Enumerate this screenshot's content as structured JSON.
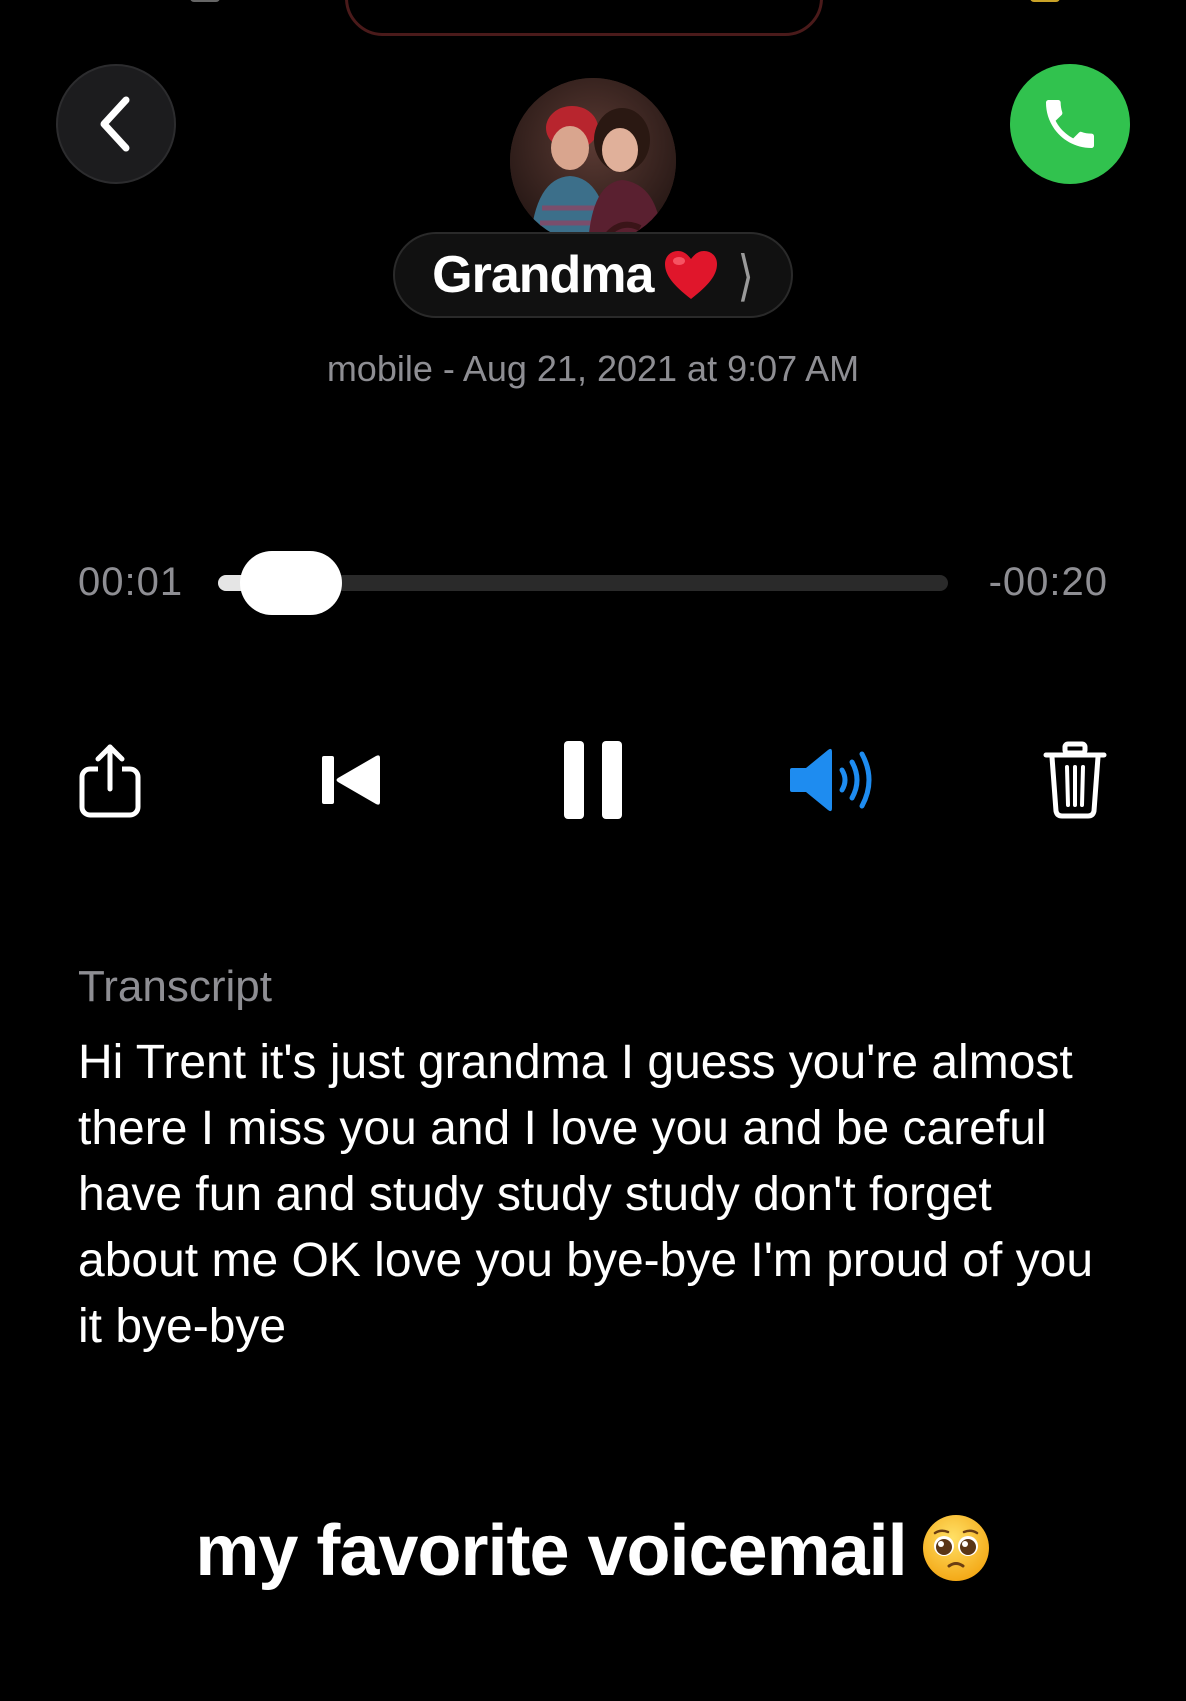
{
  "header": {
    "contact_name": "Grandma",
    "contact_emoji": "heart-icon",
    "meta_line": "mobile - Aug 21, 2021 at 9:07 AM"
  },
  "player": {
    "elapsed": "00:01",
    "remaining": "-00:20",
    "progress": 0.05
  },
  "controls": {
    "icons": [
      "share-icon",
      "skip-back-icon",
      "pause-icon",
      "speaker-icon",
      "trash-icon"
    ],
    "speaker_color": "#1e8cf0"
  },
  "transcript": {
    "label": "Transcript",
    "text": "Hi Trent it's just grandma I guess you're almost there I miss you and I love you and be careful have fun and study study study don't forget about me OK love you bye-bye I'm proud of you it bye-bye"
  },
  "caption": {
    "text": "my favorite voicemail",
    "emoji": "pleading-face-icon"
  },
  "colors": {
    "call_green": "#31c24e",
    "accent_blue": "#1e8cf0",
    "background": "#000000",
    "secondary_text": "#8e8e93"
  }
}
